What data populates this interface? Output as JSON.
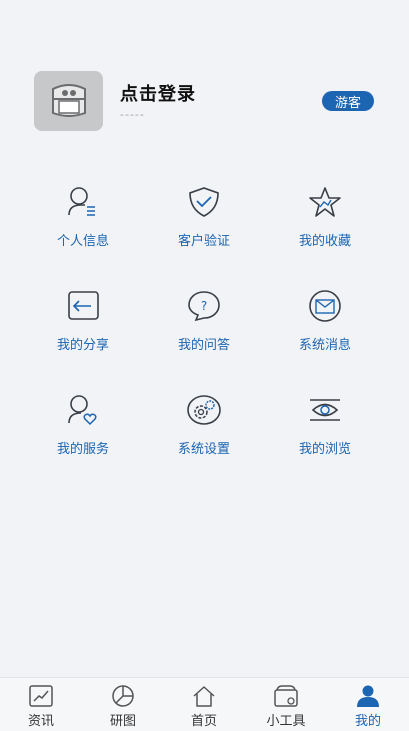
{
  "profile": {
    "login_label": "点击登录",
    "sub_label": "-----",
    "badge_label": "游客"
  },
  "menu": [
    {
      "label": "个人信息",
      "icon": "user-info-icon"
    },
    {
      "label": "客户验证",
      "icon": "shield-check-icon"
    },
    {
      "label": "我的收藏",
      "icon": "star-icon"
    },
    {
      "label": "我的分享",
      "icon": "share-icon"
    },
    {
      "label": "我的问答",
      "icon": "question-icon"
    },
    {
      "label": "系统消息",
      "icon": "mail-icon"
    },
    {
      "label": "我的服务",
      "icon": "user-heart-icon"
    },
    {
      "label": "系统设置",
      "icon": "gear-icon"
    },
    {
      "label": "我的浏览",
      "icon": "eye-icon"
    }
  ],
  "tabs": [
    {
      "label": "资讯",
      "icon": "chart-line-icon"
    },
    {
      "label": "研图",
      "icon": "pie-chart-icon"
    },
    {
      "label": "首页",
      "icon": "home-icon"
    },
    {
      "label": "小工具",
      "icon": "toolbox-icon"
    },
    {
      "label": "我的",
      "icon": "person-icon"
    }
  ],
  "colors": {
    "accent": "#1b65b2",
    "icon_stroke": "#3a3f47",
    "background": "#f2f3f6"
  }
}
